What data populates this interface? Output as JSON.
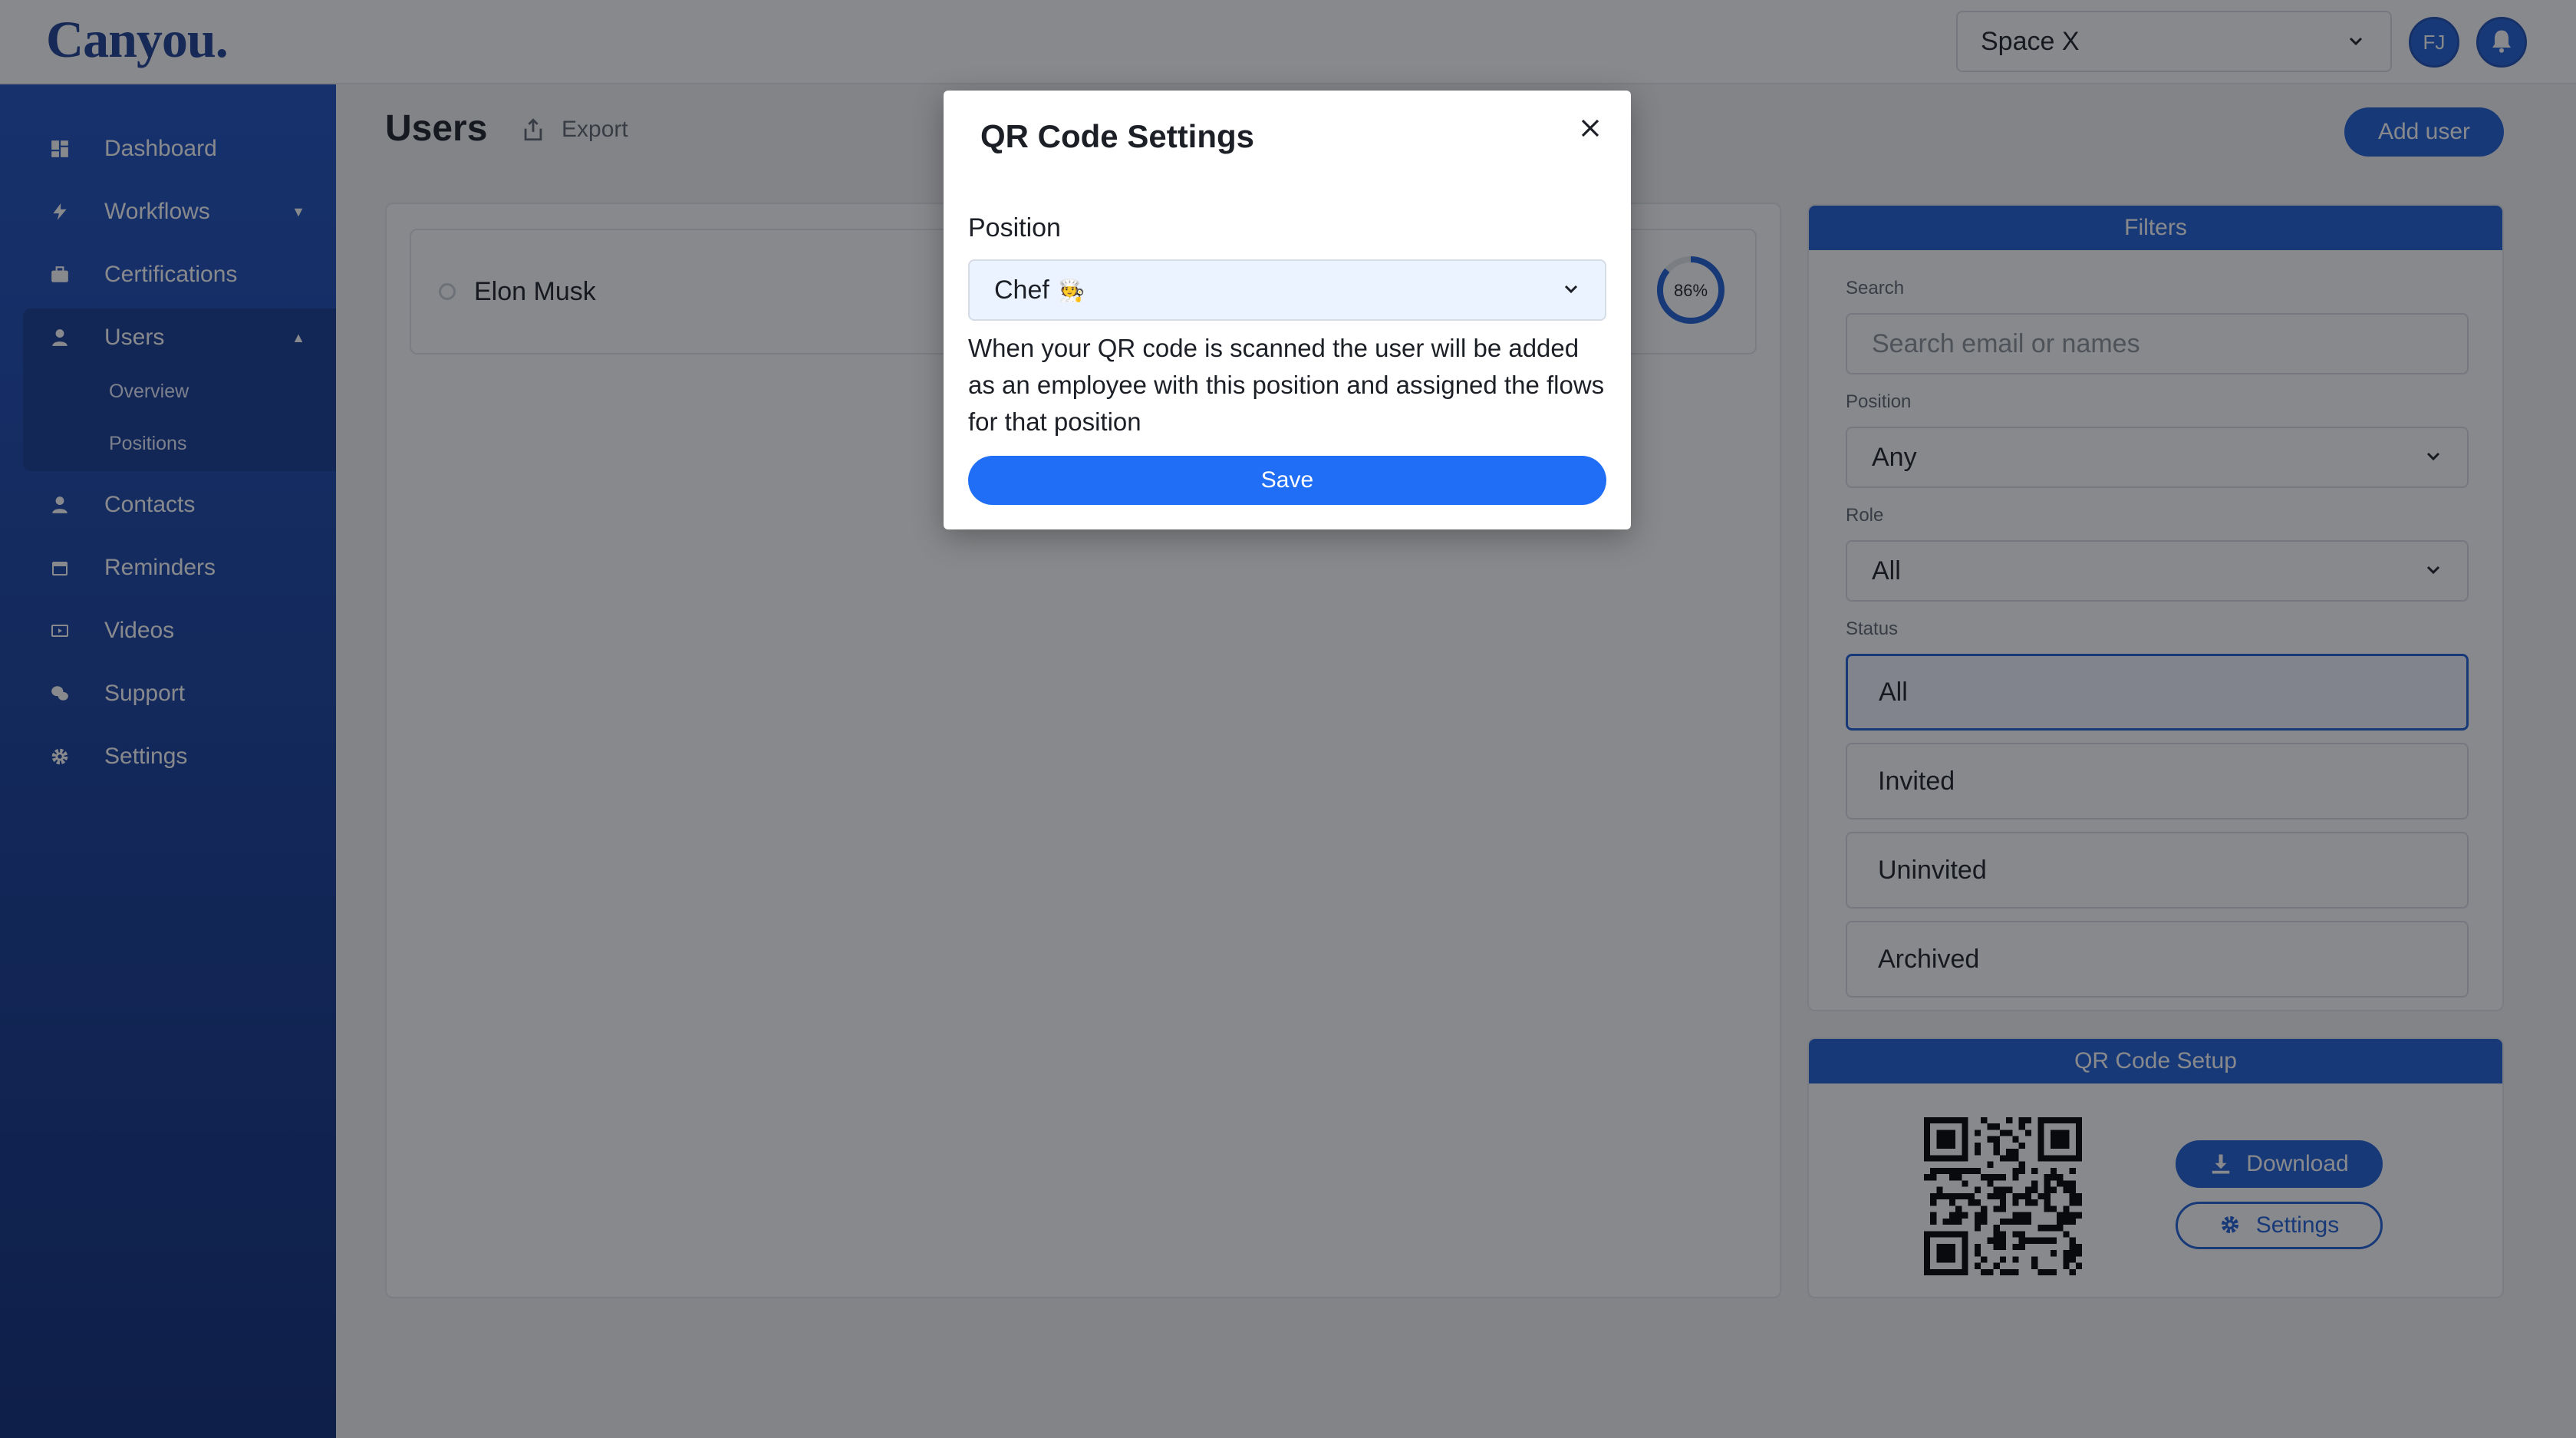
{
  "app": {
    "logo": "Canyou."
  },
  "header": {
    "space_select": "Space X",
    "avatar_initials": "FJ",
    "icons": {
      "chevron": "chevron-down-icon",
      "bell": "bell-icon"
    }
  },
  "sidebar": {
    "items": [
      {
        "label": "Dashboard",
        "icon": "dashboard-icon"
      },
      {
        "label": "Workflows",
        "icon": "bolt-icon"
      },
      {
        "label": "Certifications",
        "icon": "briefcase-icon"
      },
      {
        "label": "Users",
        "icon": "user-icon"
      },
      {
        "label": "Contacts",
        "icon": "user-icon"
      },
      {
        "label": "Reminders",
        "icon": "calendar-icon"
      },
      {
        "label": "Videos",
        "icon": "video-icon"
      },
      {
        "label": "Support",
        "icon": "chat-icon"
      },
      {
        "label": "Settings",
        "icon": "gear-icon"
      }
    ],
    "users_sub": [
      "Overview",
      "Positions"
    ]
  },
  "main": {
    "title": "Users",
    "export_label": "Export",
    "add_user_label": "Add user",
    "users": [
      {
        "name": "Elon Musk",
        "progress": 86,
        "progress_label": "86%"
      }
    ]
  },
  "filters": {
    "header": "Filters",
    "search_label": "Search",
    "search_placeholder": "Search email or names",
    "position_label": "Position",
    "position_value": "Any",
    "role_label": "Role",
    "role_value": "All",
    "status_label": "Status",
    "status_options": [
      "All",
      "Invited",
      "Uninvited",
      "Archived"
    ],
    "status_selected": "All"
  },
  "qr": {
    "header": "QR Code Setup",
    "download_label": "Download",
    "settings_label": "Settings"
  },
  "modal": {
    "title": "QR Code Settings",
    "position_label": "Position",
    "position_value": "Chef",
    "position_emoji": "🧑‍🍳",
    "description": "When your QR code is scanned the user will be added as an employee with this position and assigned the flows for that position",
    "save_label": "Save"
  },
  "colors": {
    "primary": "#1f5fd6",
    "sidebar_top": "#1c4fc0",
    "sidebar_bottom": "#0b2a78",
    "logo": "#1c3f94"
  }
}
